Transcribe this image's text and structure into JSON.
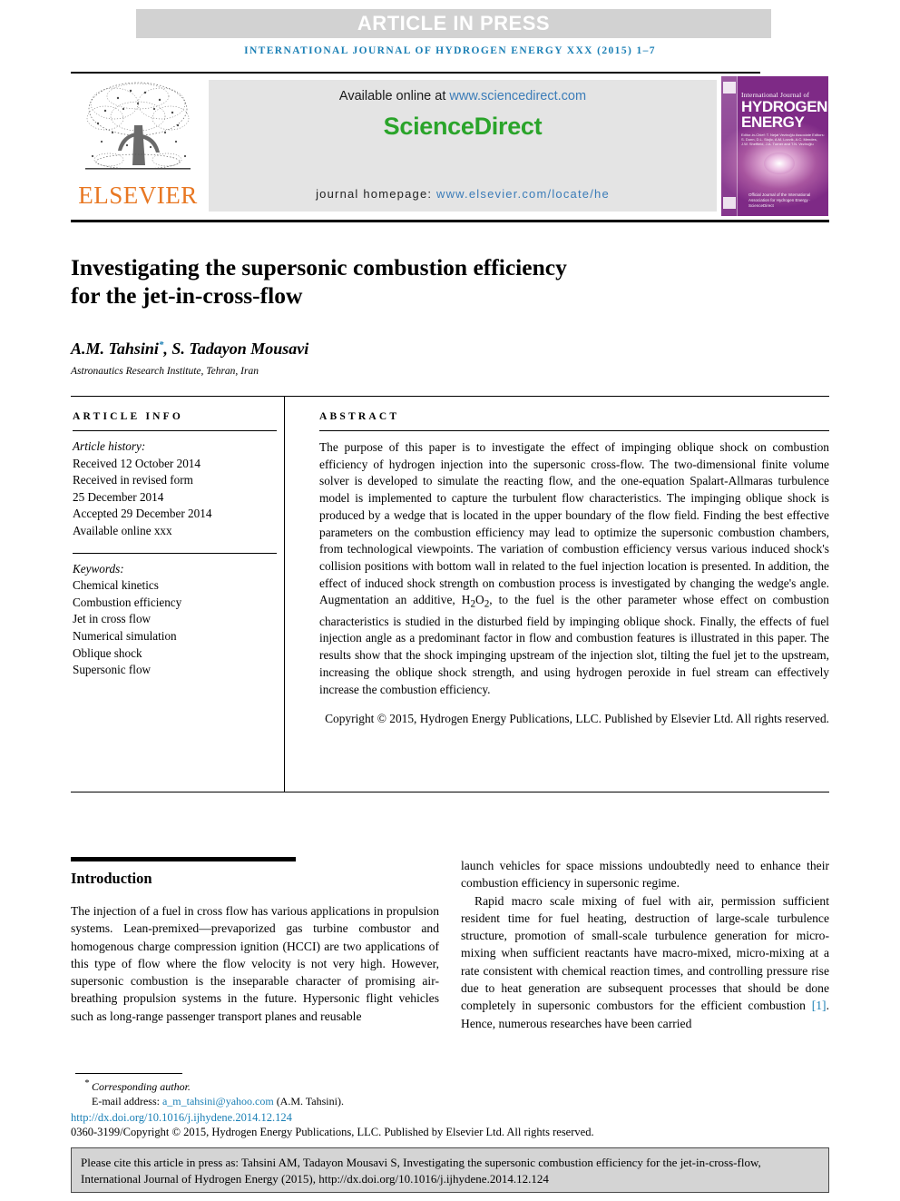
{
  "banner": {
    "article_in_press": "ARTICLE IN PRESS",
    "journal_line": "INTERNATIONAL JOURNAL OF HYDROGEN ENERGY XXX (2015) 1–7"
  },
  "masthead": {
    "publisher_name": "ELSEVIER",
    "available_online_prefix": "Available online at ",
    "available_online_link": "www.sciencedirect.com",
    "sciencedirect_logo": "ScienceDirect",
    "journal_homepage_prefix": "journal homepage: ",
    "journal_homepage_link": "www.elsevier.com/locate/he",
    "cover": {
      "small_title": "International Journal of",
      "big_title_line1": "HYDROGEN",
      "big_title_line2": "ENERGY",
      "editors": "Editor-in-Chief: T. Nejat Veziroğlu   Associate Editors: S. Dunn, D.L. Stojic, A.M. Lovvik, A.C. Mendes, J.W. Sheffield, J.A. Turner and T.N. Veziroğlu",
      "footer_note": "Official Journal of the International Association for Hydrogen Energy · ScienceDirect"
    }
  },
  "article": {
    "title_line1": "Investigating the supersonic combustion efficiency",
    "title_line2": "for the jet-in-cross-flow",
    "authors_part1": "A.M. Tahsini",
    "authors_star": "*",
    "authors_part2": ", S. Tadayon Mousavi",
    "affiliation": "Astronautics Research Institute, Tehran, Iran"
  },
  "article_info": {
    "heading": "ARTICLE INFO",
    "history_label": "Article history:",
    "history": [
      "Received 12 October 2014",
      "Received in revised form",
      "25 December 2014",
      "Accepted 29 December 2014",
      "Available online xxx"
    ],
    "keywords_label": "Keywords:",
    "keywords": [
      "Chemical kinetics",
      "Combustion efficiency",
      "Jet in cross flow",
      "Numerical simulation",
      "Oblique shock",
      "Supersonic flow"
    ]
  },
  "abstract": {
    "heading": "ABSTRACT",
    "part1": "The purpose of this paper is to investigate the effect of impinging oblique shock on combustion efficiency of hydrogen injection into the supersonic cross-flow. The two-dimensional finite volume solver is developed to simulate the reacting flow, and the one-equation Spalart-Allmaras turbulence model is implemented to capture the turbulent flow characteristics. The impinging oblique shock is produced by a wedge that is located in the upper boundary of the flow field. Finding the best effective parameters on the combustion efficiency may lead to optimize the supersonic combustion chambers, from technological viewpoints. The variation of combustion efficiency versus various induced shock's collision positions with bottom wall in related to the fuel injection location is presented. In addition, the effect of induced shock strength on combustion process is investigated by changing the wedge's angle. Augmentation an additive, ",
    "formula_h": "H",
    "formula_sub2a": "2",
    "formula_o": "O",
    "formula_sub2b": "2",
    "part2": ", to the fuel is the other parameter whose effect on combustion characteristics is studied in the disturbed field by impinging oblique shock. Finally, the effects of fuel injection angle as a predominant factor in flow and combustion features is illustrated in this paper. The results show that the shock impinging upstream of the injection slot, tilting the fuel jet to the upstream, increasing the oblique shock strength, and using hydrogen peroxide in fuel stream can effectively increase the combustion efficiency.",
    "copyright": "Copyright © 2015, Hydrogen Energy Publications, LLC. Published by Elsevier Ltd. All rights reserved."
  },
  "introduction": {
    "title": "Introduction",
    "left_paragraph": "The injection of a fuel in cross flow has various applications in propulsion systems. Lean-premixed—prevaporized gas turbine combustor and homogenous charge compression ignition (HCCI) are two applications of this type of flow where the flow velocity is not very high. However, supersonic combustion is the inseparable character of promising air-breathing propulsion systems in the future. Hypersonic flight vehicles such as long-range passenger transport planes and reusable",
    "right_paragraph_1": "launch vehicles for space missions undoubtedly need to enhance their combustion efficiency in supersonic regime.",
    "right_paragraph_2_a": "Rapid macro scale mixing of fuel with air, permission sufficient resident time for fuel heating, destruction of large-scale turbulence structure, promotion of small-scale turbulence generation for micro-mixing when sufficient reactants have macro-mixed, micro-mixing at a rate consistent with chemical reaction times, and controlling pressure rise due to heat generation are subsequent processes that should be done completely in supersonic combustors for the efficient combustion ",
    "right_citation": "[1]",
    "right_paragraph_2_b": ". Hence, numerous researches have been carried"
  },
  "footer": {
    "corresponding_star": "*",
    "corresponding_author": "Corresponding author.",
    "email_label": "E-mail address: ",
    "email_link": "a_m_tahsini@yahoo.com",
    "email_suffix": " (A.M. Tahsini).",
    "doi": "http://dx.doi.org/10.1016/j.ijhydene.2014.12.124",
    "issn_copyright": "0360-3199/Copyright © 2015, Hydrogen Energy Publications, LLC. Published by Elsevier Ltd. All rights reserved."
  },
  "cite_box": {
    "text": "Please cite this article in press as: Tahsini AM, Tadayon Mousavi S, Investigating the supersonic combustion efficiency for the jet-in-cross-flow, International Journal of Hydrogen Energy (2015), http://dx.doi.org/10.1016/j.ijhydene.2014.12.124"
  },
  "colors": {
    "link_blue": "#1a7fb5",
    "sciencedirect_green": "#2aa42a",
    "elsevier_orange": "#e87722",
    "banner_gray": "#d2d2d2"
  }
}
